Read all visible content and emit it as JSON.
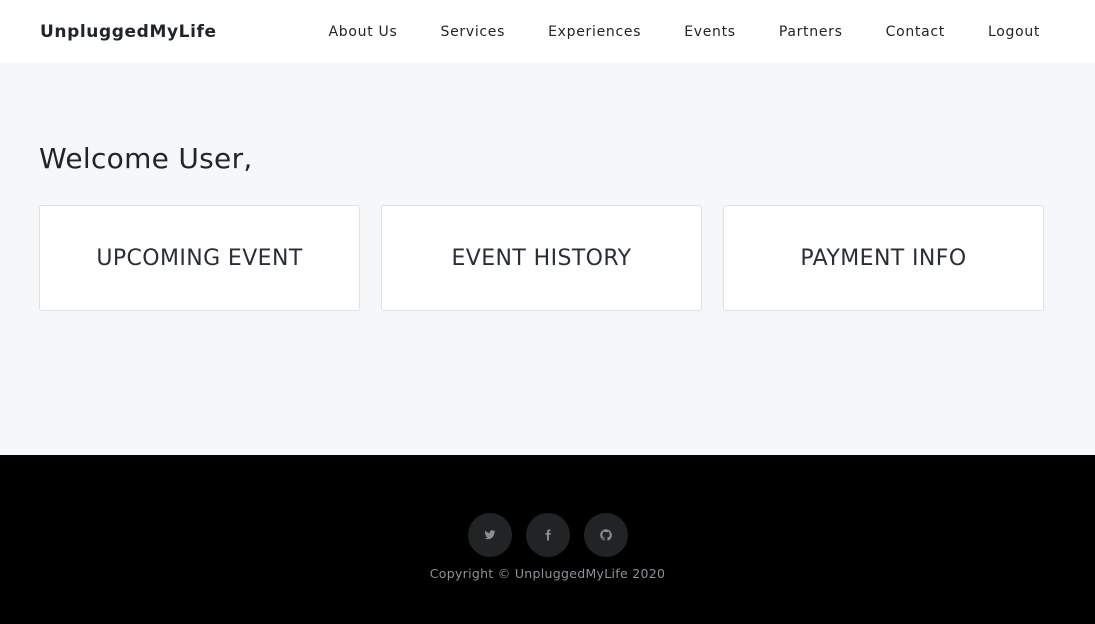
{
  "nav": {
    "brand": "UnpluggedMyLife",
    "links": [
      "About Us",
      "Services",
      "Experiences",
      "Events",
      "Partners",
      "Contact",
      "Logout"
    ]
  },
  "main": {
    "welcome": "Welcome User,",
    "cards": [
      "UPCOMING EVENT",
      "EVENT HISTORY",
      "PAYMENT INFO"
    ]
  },
  "footer": {
    "social_icons": [
      "twitter-icon",
      "facebook-icon",
      "github-icon"
    ],
    "copyright": "Copyright © UnpluggedMyLife 2020"
  },
  "colors": {
    "page_bg": "#f6f7f8",
    "footer_bg": "#000000",
    "social_bg": "#222325",
    "text": "#212529"
  }
}
